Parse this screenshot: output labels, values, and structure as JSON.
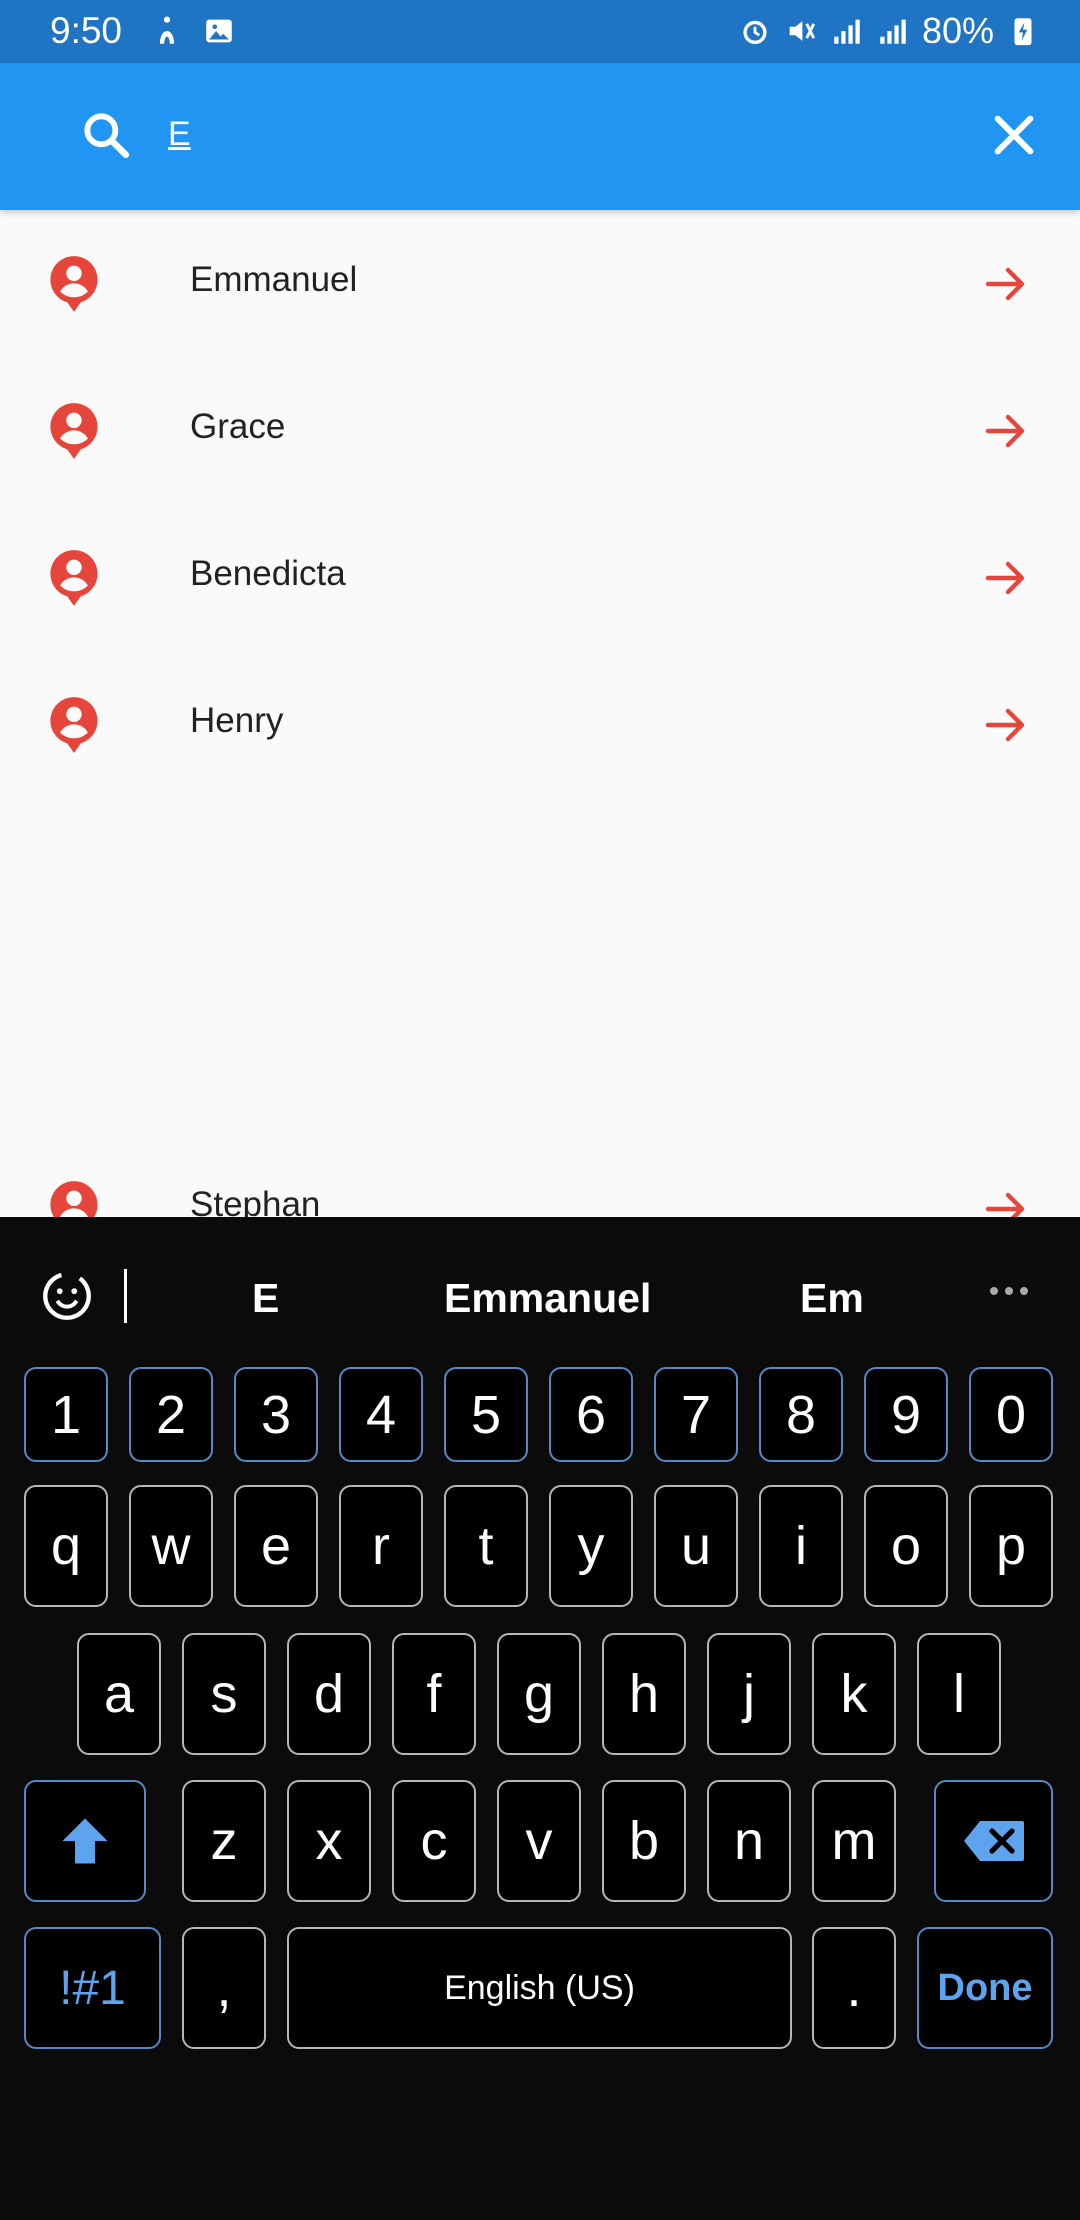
{
  "status_bar": {
    "time": "9:50",
    "battery": "80%"
  },
  "search": {
    "query": "E",
    "placeholder": ""
  },
  "results": [
    {
      "name": "Emmanuel"
    },
    {
      "name": "Grace"
    },
    {
      "name": "Benedicta"
    },
    {
      "name": "Henry"
    },
    {
      "name": "Stephan"
    }
  ],
  "keyboard": {
    "suggestions": [
      "E",
      "Emmanuel",
      "Em"
    ],
    "number_row": [
      "1",
      "2",
      "3",
      "4",
      "5",
      "6",
      "7",
      "8",
      "9",
      "0"
    ],
    "row1": [
      "q",
      "w",
      "e",
      "r",
      "t",
      "y",
      "u",
      "i",
      "o",
      "p"
    ],
    "row2": [
      "a",
      "s",
      "d",
      "f",
      "g",
      "h",
      "j",
      "k",
      "l"
    ],
    "row3": [
      "z",
      "x",
      "c",
      "v",
      "b",
      "n",
      "m"
    ],
    "symbols_label": "!#1",
    "comma_label": ",",
    "space_label": "English (US)",
    "period_label": ".",
    "done_label": "Done"
  },
  "colors": {
    "status_bar": "#1f74c3",
    "app_bar": "#2195f2",
    "accent_red": "#e5453a",
    "keyboard_bg": "#0b0b0c",
    "key_blue": "#5689c4"
  }
}
